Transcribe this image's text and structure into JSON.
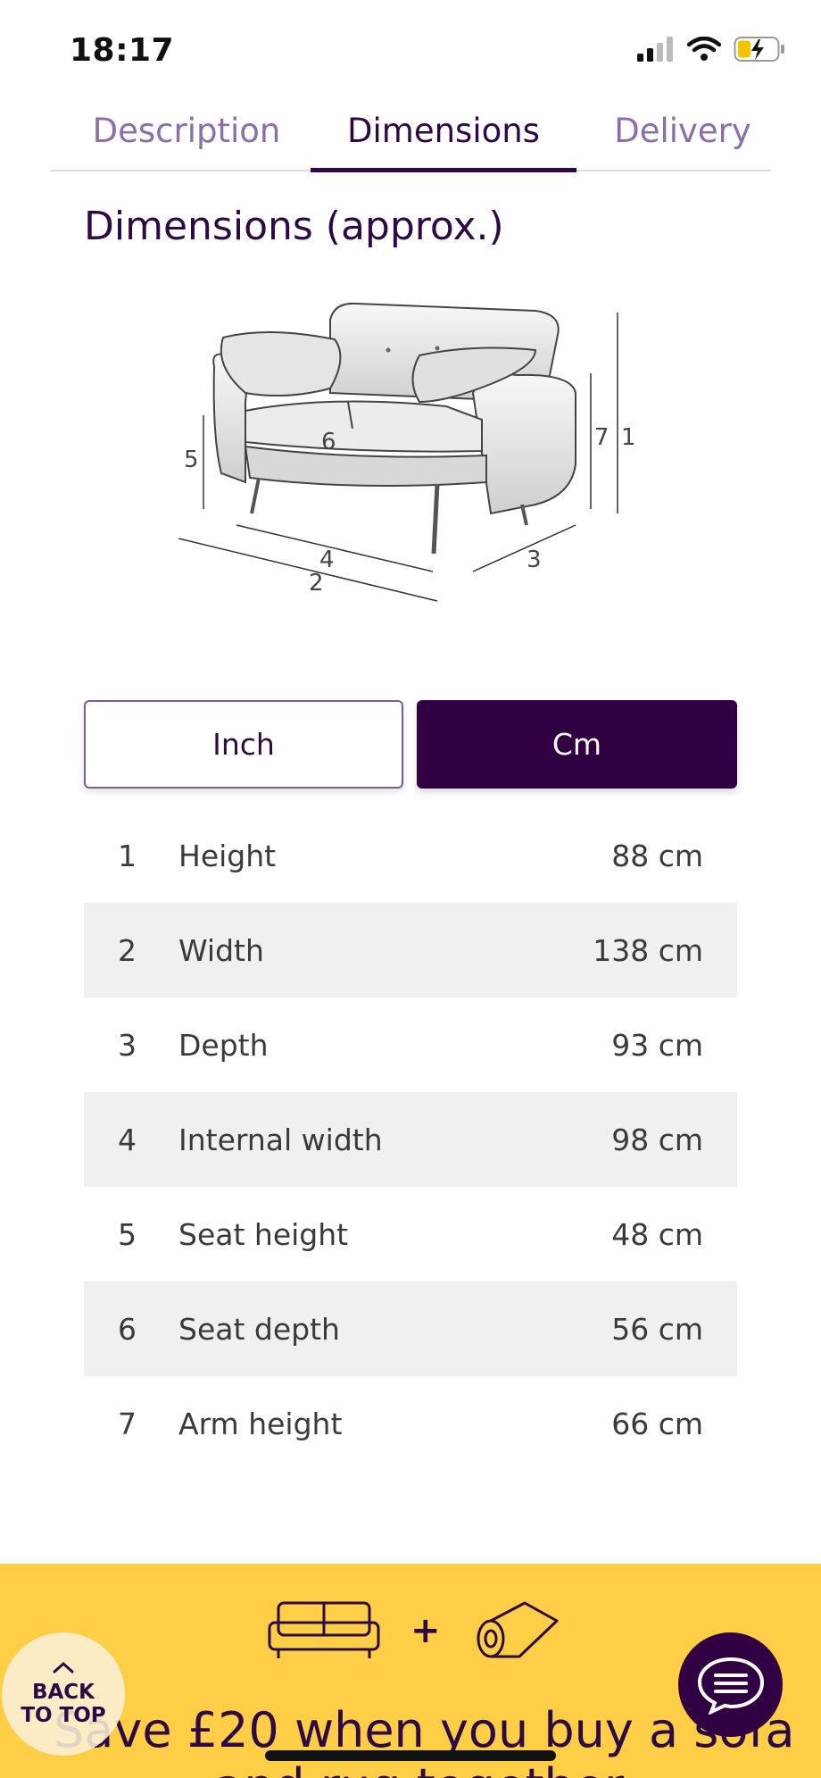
{
  "status_bar": {
    "time": "18:17"
  },
  "tabs": [
    {
      "label": "Description"
    },
    {
      "label": "Dimensions"
    },
    {
      "label": "Delivery"
    }
  ],
  "active_tab": "Dimensions",
  "section_title": "Dimensions (approx.)",
  "diagram_labels": [
    "1",
    "2",
    "3",
    "4",
    "5",
    "6",
    "7"
  ],
  "units": {
    "inch_label": "Inch",
    "cm_label": "Cm",
    "selected": "Cm"
  },
  "dimensions": [
    {
      "num": "1",
      "label": "Height",
      "value": "88 cm"
    },
    {
      "num": "2",
      "label": "Width",
      "value": "138 cm"
    },
    {
      "num": "3",
      "label": "Depth",
      "value": "93 cm"
    },
    {
      "num": "4",
      "label": "Internal width",
      "value": "98 cm"
    },
    {
      "num": "5",
      "label": "Seat height",
      "value": "48 cm"
    },
    {
      "num": "6",
      "label": "Seat depth",
      "value": "56 cm"
    },
    {
      "num": "7",
      "label": "Arm height",
      "value": "66 cm"
    }
  ],
  "promo": {
    "plus": "+",
    "text_line1": "Save £20 when you buy a sofa",
    "text_line2": "and rug together"
  },
  "back_to_top": {
    "line1": "BACK",
    "line2": "TO TOP"
  },
  "colors": {
    "brand": "#300042",
    "promo_bg": "#ffce47",
    "tab_inactive": "#8a6fa8"
  }
}
